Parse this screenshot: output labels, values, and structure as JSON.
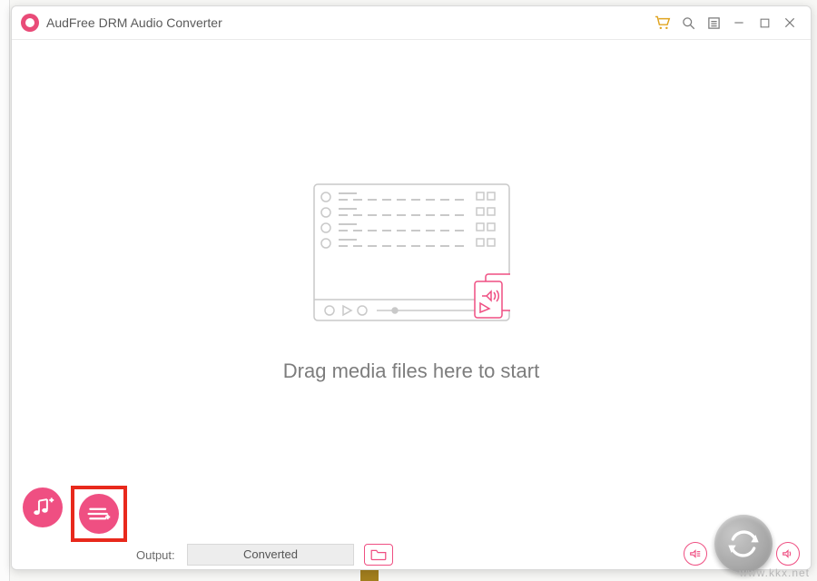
{
  "app": {
    "title": "AudFree DRM Audio Converter"
  },
  "main": {
    "drop_hint": "Drag media files here to start"
  },
  "output": {
    "label": "Output:",
    "value": "Converted"
  },
  "watermark": "www.kkx.net",
  "colors": {
    "accent": "#ef4f82",
    "highlight_box": "#e8291c",
    "cart": "#e0a420"
  }
}
